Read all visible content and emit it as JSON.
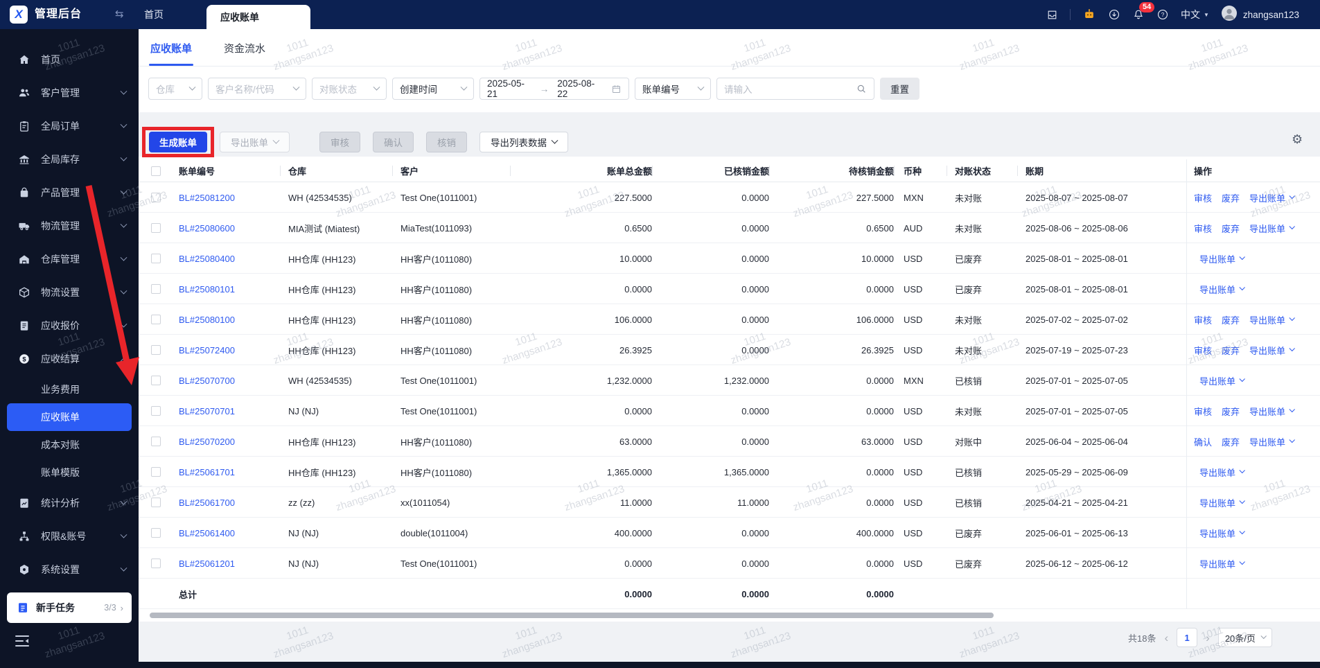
{
  "topbar": {
    "logo_letter": "X",
    "app_title": "管理后台",
    "nav_home": "首页",
    "window_tab": "应收账单",
    "badge_count": "54",
    "language": "中文",
    "username": "zhangsan123"
  },
  "sidebar": {
    "items": [
      {
        "label": "首页",
        "icon": "home"
      },
      {
        "label": "客户管理",
        "icon": "customer",
        "chevron": "down"
      },
      {
        "label": "全局订单",
        "icon": "order",
        "chevron": "down"
      },
      {
        "label": "全局库存",
        "icon": "inventory",
        "chevron": "down"
      },
      {
        "label": "产品管理",
        "icon": "product",
        "chevron": "down"
      },
      {
        "label": "物流管理",
        "icon": "logistics",
        "chevron": "down"
      },
      {
        "label": "仓库管理",
        "icon": "warehouse",
        "chevron": "down"
      },
      {
        "label": "物流设置",
        "icon": "logiset",
        "chevron": "down"
      },
      {
        "label": "应收报价",
        "icon": "quote",
        "chevron": "down"
      },
      {
        "label": "应收结算",
        "icon": "settle",
        "chevron": "up"
      },
      {
        "label": "业务费用",
        "sub": true
      },
      {
        "label": "应收账单",
        "sub": true,
        "active": true
      },
      {
        "label": "成本对账",
        "sub": true
      },
      {
        "label": "账单模版",
        "sub": true
      },
      {
        "label": "统计分析",
        "icon": "stats",
        "chevron": "down"
      },
      {
        "label": "权限&账号",
        "icon": "perm",
        "chevron": "down"
      },
      {
        "label": "系统设置",
        "icon": "sysset",
        "chevron": "down"
      }
    ],
    "newbie_task": {
      "label": "新手任务",
      "progress": "3/3",
      "arrow": "›"
    }
  },
  "tabs": [
    {
      "label": "应收账单"
    },
    {
      "label": "资金流水"
    }
  ],
  "filters": {
    "warehouse_placeholder": "仓库",
    "customer_placeholder": "客户名称/代码",
    "recon_status_placeholder": "对账状态",
    "time_type": "创建时间",
    "date_start": "2025-05-21",
    "date_end": "2025-08-22",
    "search_type": "账单编号",
    "search_placeholder": "请输入",
    "reset_label": "重置"
  },
  "toolbar": {
    "generate": "生成账单",
    "export_bill": "导出账单",
    "audit": "审核",
    "confirm": "确认",
    "writeoff": "核销",
    "export_list": "导出列表数据"
  },
  "table": {
    "columns": [
      "账单编号",
      "仓库",
      "客户",
      "账单总金额",
      "已核销金额",
      "待核销金额",
      "币种",
      "对账状态",
      "账期",
      "操作"
    ],
    "export_action": "导出账单",
    "rows": [
      {
        "bill": "BL#25081200",
        "warehouse": "WH (42534535)",
        "customer": "Test One(1011001)",
        "total": "227.5000",
        "settled": "0.0000",
        "unsettled": "227.5000",
        "currency": "MXN",
        "status": "未对账",
        "period": "2025-08-07 ~ 2025-08-07",
        "actions": [
          "审核",
          "废弃"
        ]
      },
      {
        "bill": "BL#25080600",
        "warehouse": "MIA测试 (Miatest)",
        "customer": "MiaTest(1011093)",
        "total": "0.6500",
        "settled": "0.0000",
        "unsettled": "0.6500",
        "currency": "AUD",
        "status": "未对账",
        "period": "2025-08-06 ~ 2025-08-06",
        "actions": [
          "审核",
          "废弃"
        ]
      },
      {
        "bill": "BL#25080400",
        "warehouse": "HH仓库 (HH123)",
        "customer": "HH客户(1011080)",
        "total": "10.0000",
        "settled": "0.0000",
        "unsettled": "10.0000",
        "currency": "USD",
        "status": "已废弃",
        "period": "2025-08-01 ~ 2025-08-01",
        "actions": []
      },
      {
        "bill": "BL#25080101",
        "warehouse": "HH仓库 (HH123)",
        "customer": "HH客户(1011080)",
        "total": "0.0000",
        "settled": "0.0000",
        "unsettled": "0.0000",
        "currency": "USD",
        "status": "已废弃",
        "period": "2025-08-01 ~ 2025-08-01",
        "actions": []
      },
      {
        "bill": "BL#25080100",
        "warehouse": "HH仓库 (HH123)",
        "customer": "HH客户(1011080)",
        "total": "106.0000",
        "settled": "0.0000",
        "unsettled": "106.0000",
        "currency": "USD",
        "status": "未对账",
        "period": "2025-07-02 ~ 2025-07-02",
        "actions": [
          "审核",
          "废弃"
        ]
      },
      {
        "bill": "BL#25072400",
        "warehouse": "HH仓库 (HH123)",
        "customer": "HH客户(1011080)",
        "total": "26.3925",
        "settled": "0.0000",
        "unsettled": "26.3925",
        "currency": "USD",
        "status": "未对账",
        "period": "2025-07-19 ~ 2025-07-23",
        "actions": [
          "审核",
          "废弃"
        ]
      },
      {
        "bill": "BL#25070700",
        "warehouse": "WH (42534535)",
        "customer": "Test One(1011001)",
        "total": "1,232.0000",
        "settled": "1,232.0000",
        "unsettled": "0.0000",
        "currency": "MXN",
        "status": "已核销",
        "period": "2025-07-01 ~ 2025-07-05",
        "actions": []
      },
      {
        "bill": "BL#25070701",
        "warehouse": "NJ (NJ)",
        "customer": "Test One(1011001)",
        "total": "0.0000",
        "settled": "0.0000",
        "unsettled": "0.0000",
        "currency": "USD",
        "status": "未对账",
        "period": "2025-07-01 ~ 2025-07-05",
        "actions": [
          "审核",
          "废弃"
        ]
      },
      {
        "bill": "BL#25070200",
        "warehouse": "HH仓库 (HH123)",
        "customer": "HH客户(1011080)",
        "total": "63.0000",
        "settled": "0.0000",
        "unsettled": "63.0000",
        "currency": "USD",
        "status": "对账中",
        "period": "2025-06-04 ~ 2025-06-04",
        "actions": [
          "确认",
          "废弃"
        ]
      },
      {
        "bill": "BL#25061701",
        "warehouse": "HH仓库 (HH123)",
        "customer": "HH客户(1011080)",
        "total": "1,365.0000",
        "settled": "1,365.0000",
        "unsettled": "0.0000",
        "currency": "USD",
        "status": "已核销",
        "period": "2025-05-29 ~ 2025-06-09",
        "actions": []
      },
      {
        "bill": "BL#25061700",
        "warehouse": "zz (zz)",
        "customer": "xx(1011054)",
        "total": "11.0000",
        "settled": "11.0000",
        "unsettled": "0.0000",
        "currency": "USD",
        "status": "已核销",
        "period": "2025-04-21 ~ 2025-04-21",
        "actions": []
      },
      {
        "bill": "BL#25061400",
        "warehouse": "NJ (NJ)",
        "customer": "double(1011004)",
        "total": "400.0000",
        "settled": "0.0000",
        "unsettled": "400.0000",
        "currency": "USD",
        "status": "已废弃",
        "period": "2025-06-01 ~ 2025-06-13",
        "actions": []
      },
      {
        "bill": "BL#25061201",
        "warehouse": "NJ (NJ)",
        "customer": "Test One(1011001)",
        "total": "0.0000",
        "settled": "0.0000",
        "unsettled": "0.0000",
        "currency": "USD",
        "status": "已废弃",
        "period": "2025-06-12 ~ 2025-06-12",
        "actions": []
      }
    ],
    "total_row": {
      "label": "总计",
      "total": "0.0000",
      "settled": "0.0000",
      "unsettled": "0.0000"
    }
  },
  "pagination": {
    "total": "共18条",
    "page": "1",
    "page_size": "20条/页"
  },
  "watermark": {
    "line1": "1011",
    "line2": "zhangsan123"
  },
  "colors": {
    "accent": "#2e5af0",
    "primary_button": "#2346e8",
    "annotation_red": "#e8252a",
    "active_menu": "#2c5cf5",
    "badge": "#f5313d",
    "robot": "#f5a623"
  }
}
